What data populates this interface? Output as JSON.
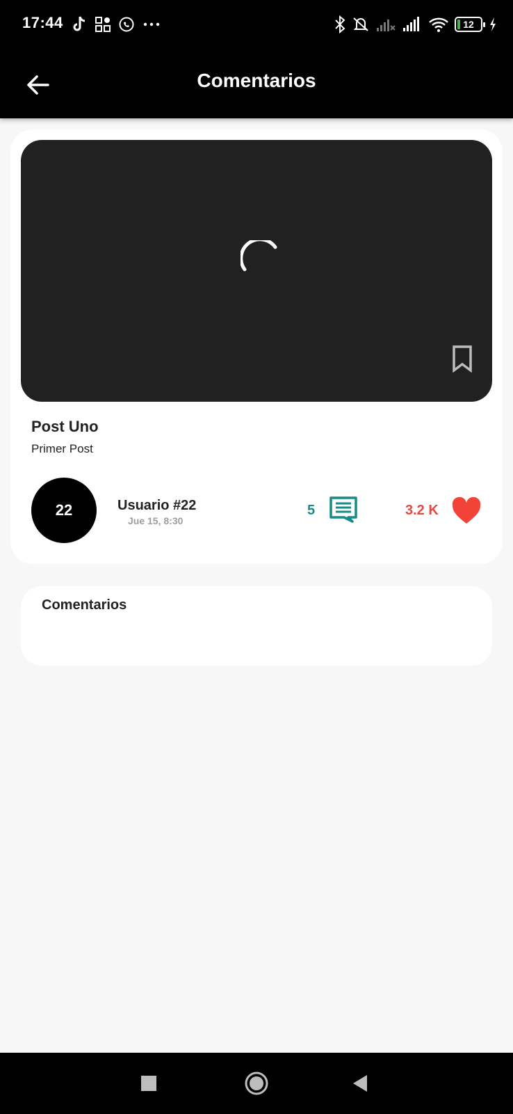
{
  "status": {
    "time": "17:44",
    "battery": "12",
    "left_icons": [
      "tiktok-icon",
      "apps-icon",
      "whatsapp-icon",
      "more-icon"
    ],
    "right_icons": [
      "bluetooth-icon",
      "bell-off-icon",
      "signal-x-icon",
      "signal-icon",
      "wifi-icon",
      "battery-icon",
      "charging-icon"
    ]
  },
  "appbar": {
    "title": "Comentarios",
    "back_icon": "arrow-back-icon"
  },
  "post": {
    "title": "Post Uno",
    "subtitle": "Primer Post",
    "media_state": "loading",
    "bookmark_icon": "bookmark-outline-icon",
    "author": {
      "avatar_text": "22",
      "name": "Usuario #22",
      "date": "Jue 15, 8:30"
    },
    "comments_count": "5",
    "likes_count": "3.2 K",
    "colors": {
      "comments": "#168c86",
      "likes": "#e14b45",
      "media_bg": "#212121"
    }
  },
  "comments_section": {
    "title": "Comentarios"
  },
  "navbar": {
    "items": [
      "recent-apps-icon",
      "home-icon",
      "back-icon"
    ]
  }
}
